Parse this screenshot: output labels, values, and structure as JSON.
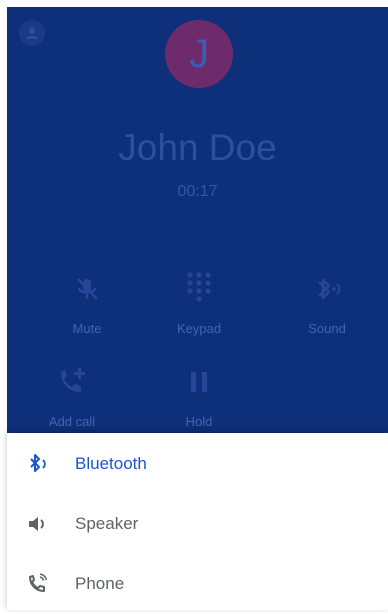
{
  "call": {
    "avatar_initial": "J",
    "caller_name": "John Doe",
    "timer": "00:17"
  },
  "controls": [
    {
      "label": "Mute",
      "icon": "mic-off-icon"
    },
    {
      "label": "Keypad",
      "icon": "dialpad-icon"
    },
    {
      "label": "Sound",
      "icon": "bluetooth-audio-icon"
    },
    {
      "label": "Add call",
      "icon": "add-call-icon"
    },
    {
      "label": "Hold",
      "icon": "pause-icon"
    }
  ],
  "audio_options": [
    {
      "label": "Bluetooth",
      "icon": "bluetooth-icon",
      "selected": true
    },
    {
      "label": "Speaker",
      "icon": "speaker-icon",
      "selected": false
    },
    {
      "label": "Phone",
      "icon": "phone-icon",
      "selected": false
    }
  ],
  "colors": {
    "call_background": "#0e2f7a",
    "avatar": "#6e2b6b",
    "selected_option": "#1a56c9",
    "option_text": "#5f6368"
  }
}
